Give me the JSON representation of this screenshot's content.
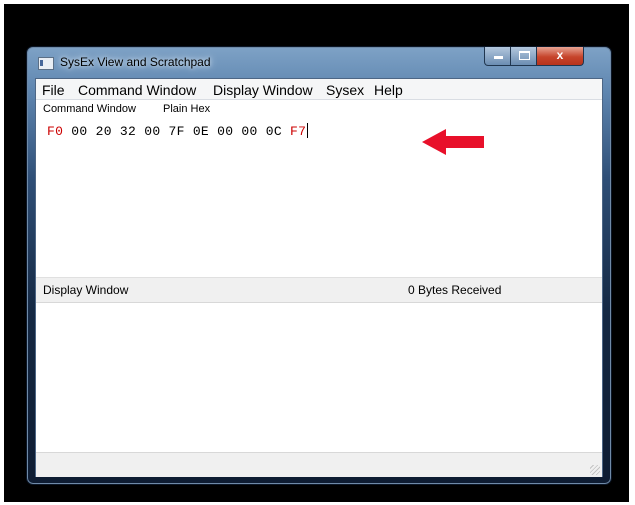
{
  "window": {
    "title": "SysEx View and Scratchpad",
    "close_glyph": "x"
  },
  "menu": {
    "items": [
      "File",
      "Command Window",
      "Display Window",
      "Sysex",
      "Help"
    ]
  },
  "tabs": [
    "Command Window",
    "Plain Hex"
  ],
  "command": {
    "bytes_start": "F0",
    "bytes_middle": " 00 20 32 00 7F 0E 00 00 0C ",
    "bytes_end": "F7",
    "accent_color": "#cc0000",
    "arrow_icon": "red-arrow-icon",
    "arrow_color": "#e8102a"
  },
  "display": {
    "label": "Display Window",
    "bytes_received": "0  Bytes Received"
  },
  "colors": {
    "backdrop": "#000000",
    "frame": "#2f4f77"
  }
}
